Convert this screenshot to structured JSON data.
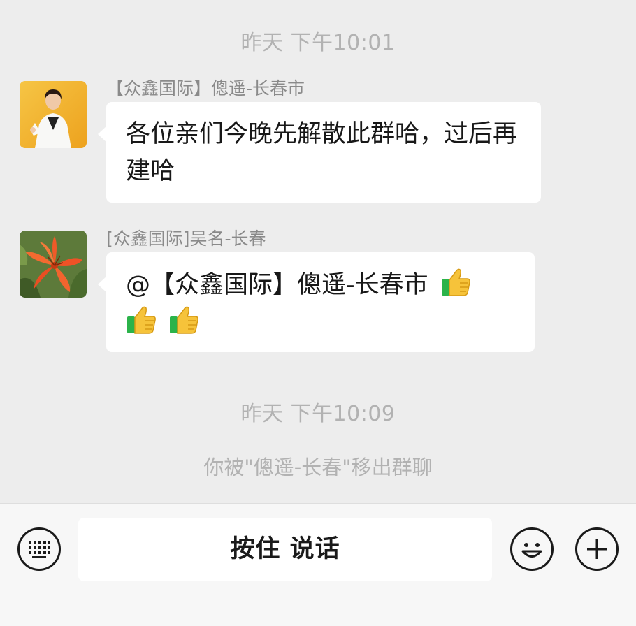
{
  "messages_area": {
    "timestamp_1": "昨天 下午10:01",
    "message_1": {
      "sender": "【众鑫国际】傯遥-长春市",
      "text": "各位亲们今晚先解散此群哈，过后再建哈",
      "avatar": "person-avatar"
    },
    "message_2": {
      "sender": "[众鑫国际]吴名-长春",
      "mention": "@【众鑫国际】傯遥-长春市",
      "emoji": "thumbs-up-icon",
      "avatar": "lily-flower-avatar"
    },
    "timestamp_2": "昨天 下午10:09",
    "system_notice": "你被\"傯遥-长春\"移出群聊"
  },
  "input_bar": {
    "keyboard_icon": "keyboard-icon",
    "hold_to_talk_label": "按住 说话",
    "emoji_icon": "smiley-icon",
    "add_icon": "plus-icon"
  }
}
